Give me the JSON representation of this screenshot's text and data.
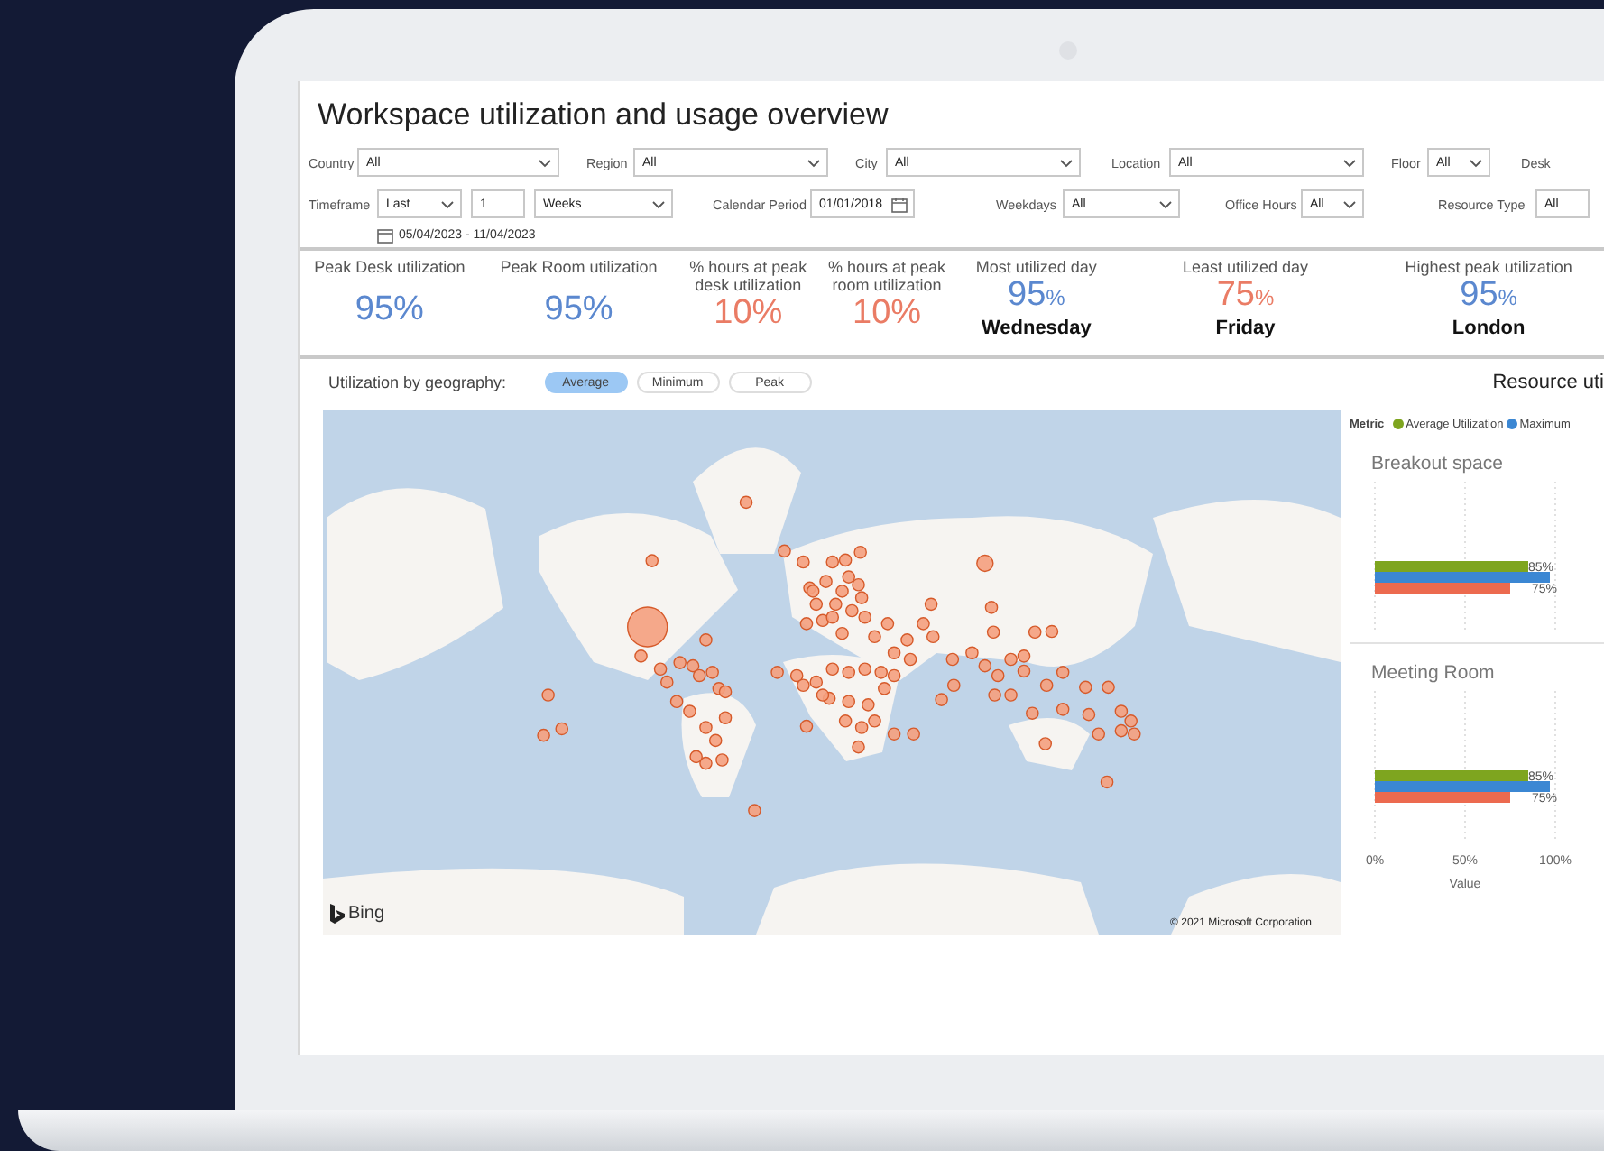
{
  "title": "Workspace utilization and usage overview",
  "filter_rows": [
    [
      {
        "label": "Country",
        "controls": [
          {
            "kind": "dropdown",
            "value": "All"
          }
        ]
      },
      {
        "label": "Region",
        "controls": [
          {
            "kind": "dropdown",
            "value": "All"
          }
        ]
      },
      {
        "label": "City",
        "controls": [
          {
            "kind": "dropdown",
            "value": "All"
          }
        ]
      },
      {
        "label": "Location",
        "controls": [
          {
            "kind": "dropdown",
            "value": "All"
          }
        ]
      },
      {
        "label": "Floor",
        "controls": [
          {
            "kind": "dropdown",
            "value": "All"
          }
        ]
      },
      {
        "label": "Desk"
      }
    ],
    [
      {
        "label": "Timeframe",
        "controls": [
          {
            "kind": "dropdown",
            "value": "Last"
          },
          {
            "kind": "input",
            "value": "1"
          },
          {
            "kind": "dropdown",
            "value": "Weeks"
          }
        ]
      },
      {
        "label": "Calendar Period",
        "controls": [
          {
            "kind": "date",
            "value": "01/01/2018"
          }
        ]
      },
      {
        "label": "Weekdays",
        "controls": [
          {
            "kind": "dropdown",
            "value": "All"
          }
        ]
      },
      {
        "label": "Office Hours",
        "controls": [
          {
            "kind": "dropdown",
            "value": "All"
          }
        ]
      },
      {
        "label": "Resource Type",
        "controls": [
          {
            "kind": "field",
            "value": "All"
          }
        ]
      }
    ]
  ],
  "date_range": "05/04/2023 - 11/04/2023",
  "kpis": [
    {
      "label": "Peak Desk utilization",
      "value": "95%",
      "color": "#5b88cf"
    },
    {
      "label": "Peak Room utilization",
      "value": "95%",
      "color": "#5b88cf"
    },
    {
      "label": "% hours at peak desk utilization",
      "value": "10%",
      "color": "#ea7c65"
    },
    {
      "label": "% hours at peak room utilization",
      "value": "10%",
      "color": "#ea7c65"
    },
    {
      "label": "Most utilized day",
      "value": "95",
      "unit": "%",
      "color": "#5b88cf",
      "detail": "Wednesday"
    },
    {
      "label": "Least utilized day",
      "value": "75",
      "unit": "%",
      "color": "#ea7c65",
      "detail": "Friday"
    },
    {
      "label": "Highest peak utilization",
      "value": "95",
      "unit": "%",
      "color": "#5b88cf",
      "detail": "London"
    }
  ],
  "geography": {
    "label": "Utilization by geography:",
    "options": [
      {
        "label": "Average",
        "selected": true
      },
      {
        "label": "Minimum",
        "selected": false
      },
      {
        "label": "Peak",
        "selected": false
      }
    ]
  },
  "map": {
    "logo": "Bing",
    "copyright": "© 2021 Microsoft Corporation"
  },
  "resource_panel": {
    "title": "Resource uti",
    "legend_title": "Metric",
    "charts": [
      {
        "chart_data": {
          "type": "bar",
          "orientation": "horizontal",
          "title": "Breakout space",
          "xlim": [
            0,
            100
          ],
          "series": [
            {
              "name": "Average Utilization",
              "color": "#7ea51f",
              "values": [
                85
              ]
            },
            {
              "name": "Maximum",
              "color": "#3b87d3",
              "values": [
                97
              ]
            },
            {
              "color": "#ec6a4f",
              "values": [
                75
              ]
            }
          ],
          "value_labels": [
            "85%",
            null,
            "75%"
          ]
        }
      },
      {
        "chart_data": {
          "type": "bar",
          "orientation": "horizontal",
          "title": "Meeting Room",
          "xlabel": "Value",
          "xlim": [
            0,
            100
          ],
          "xticks": [
            {
              "value": 0,
              "label": "0%"
            },
            {
              "value": 50,
              "label": "50%"
            },
            {
              "value": 100,
              "label": "100%"
            }
          ],
          "series": [
            {
              "color": "#7ea51f",
              "values": [
                85
              ]
            },
            {
              "color": "#3b87d3",
              "values": [
                97
              ]
            },
            {
              "color": "#ec6a4f",
              "values": [
                75
              ]
            }
          ],
          "value_labels": [
            "85%",
            null,
            "75%"
          ]
        }
      }
    ]
  }
}
